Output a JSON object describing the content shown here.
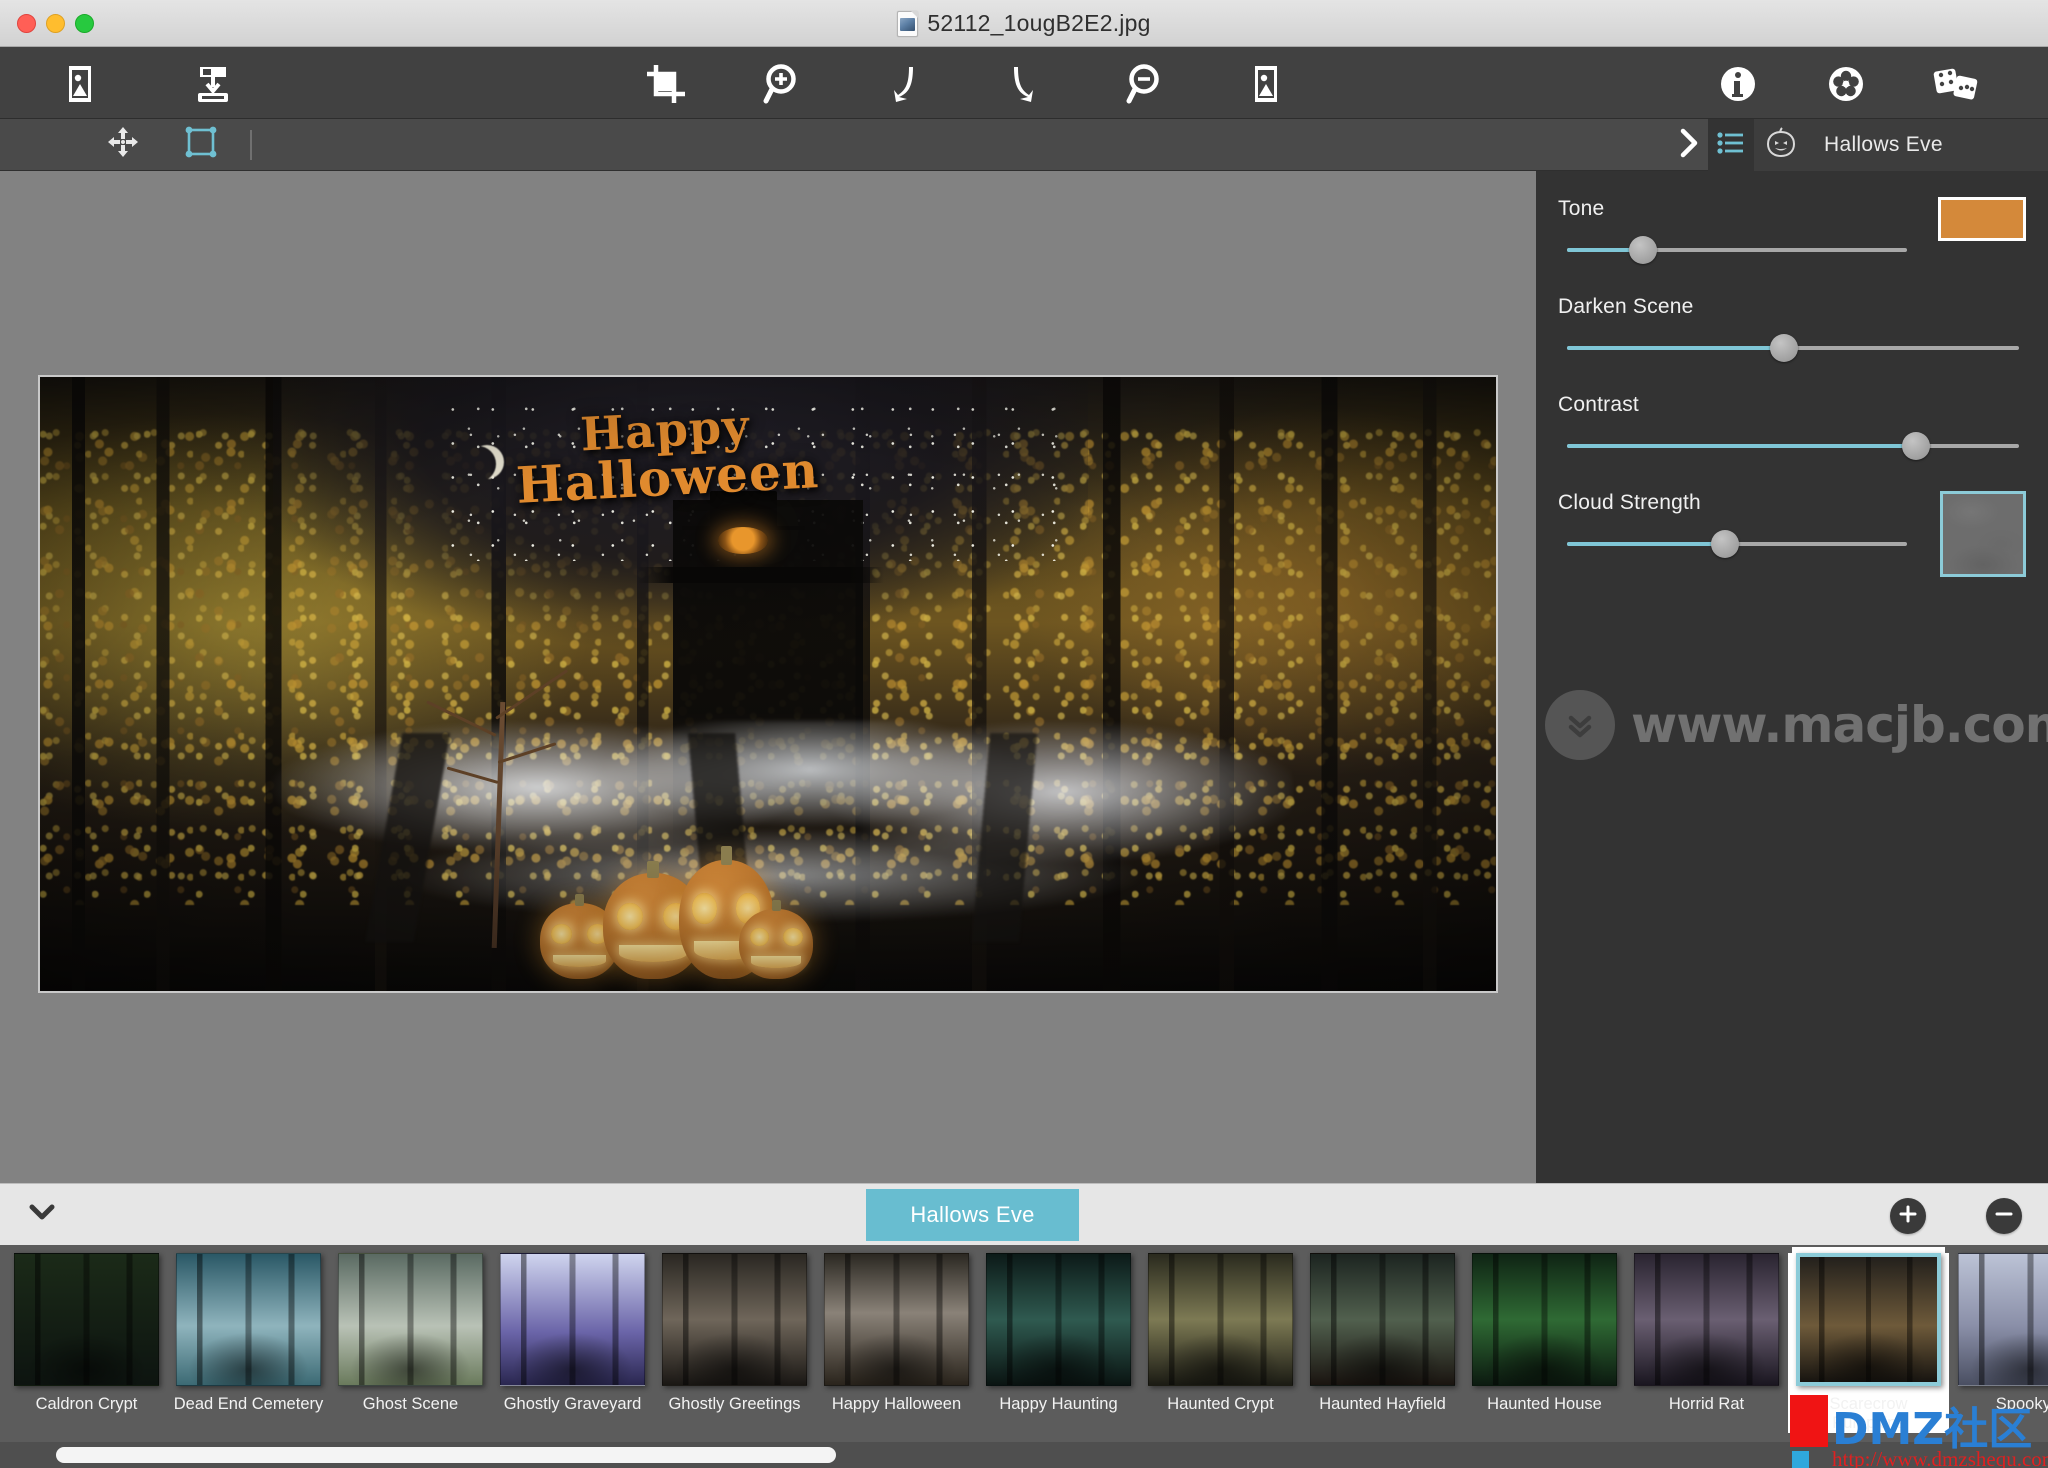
{
  "window": {
    "title": "52112_1ougB2E2.jpg",
    "traffic_lights": [
      "close",
      "minimize",
      "zoom"
    ]
  },
  "toolbar": {
    "items": [
      {
        "name": "open-image-button",
        "icon": "image-open-icon",
        "label": "Open Image"
      },
      {
        "name": "save-image-button",
        "icon": "image-save-icon",
        "label": "Save Image"
      },
      {
        "name": "crop-button",
        "icon": "crop-icon",
        "label": "Crop"
      },
      {
        "name": "zoom-in-button",
        "icon": "magnifier-plus-icon",
        "label": "Zoom In"
      },
      {
        "name": "rotate-left-button",
        "icon": "rotate-left-icon",
        "label": "Rotate Left"
      },
      {
        "name": "rotate-right-button",
        "icon": "rotate-right-icon",
        "label": "Rotate Right"
      },
      {
        "name": "zoom-out-button",
        "icon": "magnifier-minus-icon",
        "label": "Zoom Out"
      },
      {
        "name": "fit-image-button",
        "icon": "image-fit-icon",
        "label": "Fit Image"
      },
      {
        "name": "info-button",
        "icon": "info-icon",
        "label": "Info"
      },
      {
        "name": "effects-button",
        "icon": "flower-icon",
        "label": "Effects"
      },
      {
        "name": "random-button",
        "icon": "dice-icon",
        "label": "Randomize"
      }
    ]
  },
  "options_bar": {
    "move_tool": "move-tool",
    "select_tool": "selection-tool",
    "expand_label": "›"
  },
  "panel": {
    "list_icon": "list-icon",
    "theme_icon": "pumpkin-icon",
    "title": "Hallows Eve",
    "sliders": [
      {
        "label": "Tone",
        "value": 25,
        "has_swatch": true,
        "swatch_color": "#d4893a"
      },
      {
        "label": "Darken Scene",
        "value": 50,
        "has_swatch": false
      },
      {
        "label": "Contrast",
        "value": 79,
        "has_swatch": false
      },
      {
        "label": "Cloud Strength",
        "value": 49,
        "has_swatch": true,
        "swatch_type": "cloud"
      }
    ]
  },
  "watermark": {
    "text": "www.macjb.com",
    "icon": "double-chevron-down-icon"
  },
  "overlay_watermark": {
    "brand": "DMZ社区",
    "url": "http://www.dmzshequ.com"
  },
  "bottom_bar": {
    "collapse_icon": "chevron-down-icon",
    "active_tab": "Hallows Eve",
    "add_button": "add-icon",
    "remove_button": "remove-icon"
  },
  "filmstrip": {
    "items": [
      {
        "label": "Caldron Crypt",
        "selected": false,
        "theme": "crypt"
      },
      {
        "label": "Dead End Cemetery",
        "selected": false,
        "theme": "cemetery"
      },
      {
        "label": "Ghost Scene",
        "selected": false,
        "theme": "ghosthouse"
      },
      {
        "label": "Ghostly Graveyard",
        "selected": false,
        "theme": "graveyard"
      },
      {
        "label": "Ghostly Greetings",
        "selected": false,
        "theme": "greetings"
      },
      {
        "label": "Happy Halloween",
        "selected": false,
        "theme": "halloween"
      },
      {
        "label": "Happy Haunting",
        "selected": false,
        "theme": "haunting"
      },
      {
        "label": "Haunted Crypt",
        "selected": false,
        "theme": "hcrypt"
      },
      {
        "label": "Haunted Hayfield",
        "selected": false,
        "theme": "hayfield"
      },
      {
        "label": "Haunted House",
        "selected": false,
        "theme": "house"
      },
      {
        "label": "Horrid Rat",
        "selected": false,
        "theme": "rat"
      },
      {
        "label": "Scarecrow Pumpkins",
        "selected": true,
        "theme": "scarecrow"
      },
      {
        "label": "Spooky T",
        "selected": false,
        "theme": "spooky"
      }
    ]
  },
  "image": {
    "overlay_line1": "Happy",
    "overlay_line2": "Halloween"
  }
}
